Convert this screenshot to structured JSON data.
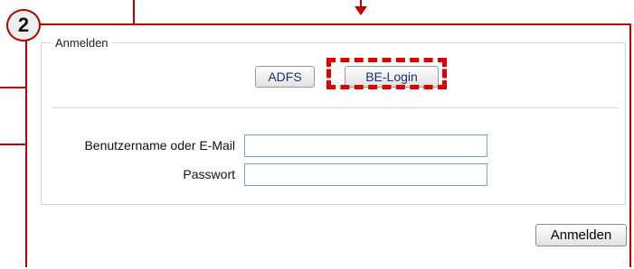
{
  "step_badge": "2",
  "login_section": {
    "legend": "Anmelden",
    "auth_buttons": [
      {
        "label": "ADFS"
      },
      {
        "label": "BE-Login"
      }
    ]
  },
  "form": {
    "username_label": "Benutzername oder E-Mail",
    "username_value": "",
    "password_label": "Passwort",
    "password_value": ""
  },
  "submit_label": "Anmelden",
  "colors": {
    "annotation_red": "#c00000",
    "highlight_red": "#e00000",
    "fieldset_border": "#c8d6e8",
    "input_border": "#7fa1d0"
  }
}
